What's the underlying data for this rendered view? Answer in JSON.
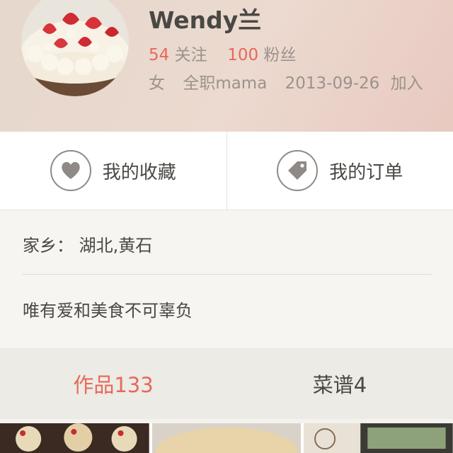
{
  "profile": {
    "name": "Wendy兰",
    "follow_count": "54",
    "follow_label": "关注",
    "fans_count": "100",
    "fans_label": "粉丝",
    "gender": "女",
    "occupation": "全职mama",
    "join_date": "2013-09-26",
    "join_label": "加入"
  },
  "actions": [
    {
      "label": "我的收藏",
      "icon": "heart-icon"
    },
    {
      "label": "我的订单",
      "icon": "tag-icon"
    }
  ],
  "info": {
    "hometown": "家乡：  湖北,黄石",
    "motto": "唯有爱和美食不可辜负"
  },
  "tabs": [
    {
      "label": "作品133",
      "active": true
    },
    {
      "label": "菜谱4",
      "active": false
    }
  ],
  "colors": {
    "accent": "#e8685a",
    "text": "#4a4844",
    "muted": "#9a938c"
  }
}
